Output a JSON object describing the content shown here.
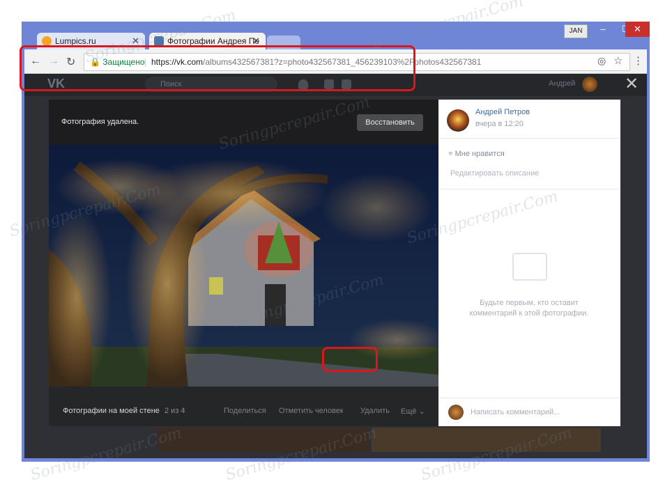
{
  "browser": {
    "tabs": [
      {
        "label": "Lumpics.ru",
        "icon": "lumpics-favicon-icon"
      },
      {
        "label": "Фотографии Андрея Пе",
        "icon": "vk-favicon-icon"
      }
    ],
    "user_badge": "JAN",
    "secure_label": "Защищено",
    "url_host": "https://vk.com",
    "url_path": "/albums432567381?z=photo432567381_456239103%2Fphotos432567381"
  },
  "vk": {
    "search_placeholder": "Поиск",
    "user_name": "Андрей",
    "close_symbol": "✕"
  },
  "viewer": {
    "deleted_message": "Фотография удалена.",
    "restore_label": "Восстановить",
    "album_title": "Фотографии на моей стене",
    "counter": "2 из 4",
    "actions": {
      "share": "Поделиться",
      "tag": "Отметить человека",
      "delete": "Удалить",
      "more": "Ещё"
    }
  },
  "side_panel": {
    "author_name": "Андрей Петров",
    "author_date": "вчера в 12:20",
    "like_label": "Мне нравится",
    "edit_description": "Редактировать описание",
    "empty_comments": "Будьте первым, кто оставит комментарий к этой фотографии.",
    "comment_placeholder": "Написать комментарий..."
  },
  "watermark_text": "Soringpcrepair.Com",
  "colors": {
    "highlight": "#d8171f",
    "page_bg": "#2e3035",
    "link": "#3a6ea5"
  }
}
